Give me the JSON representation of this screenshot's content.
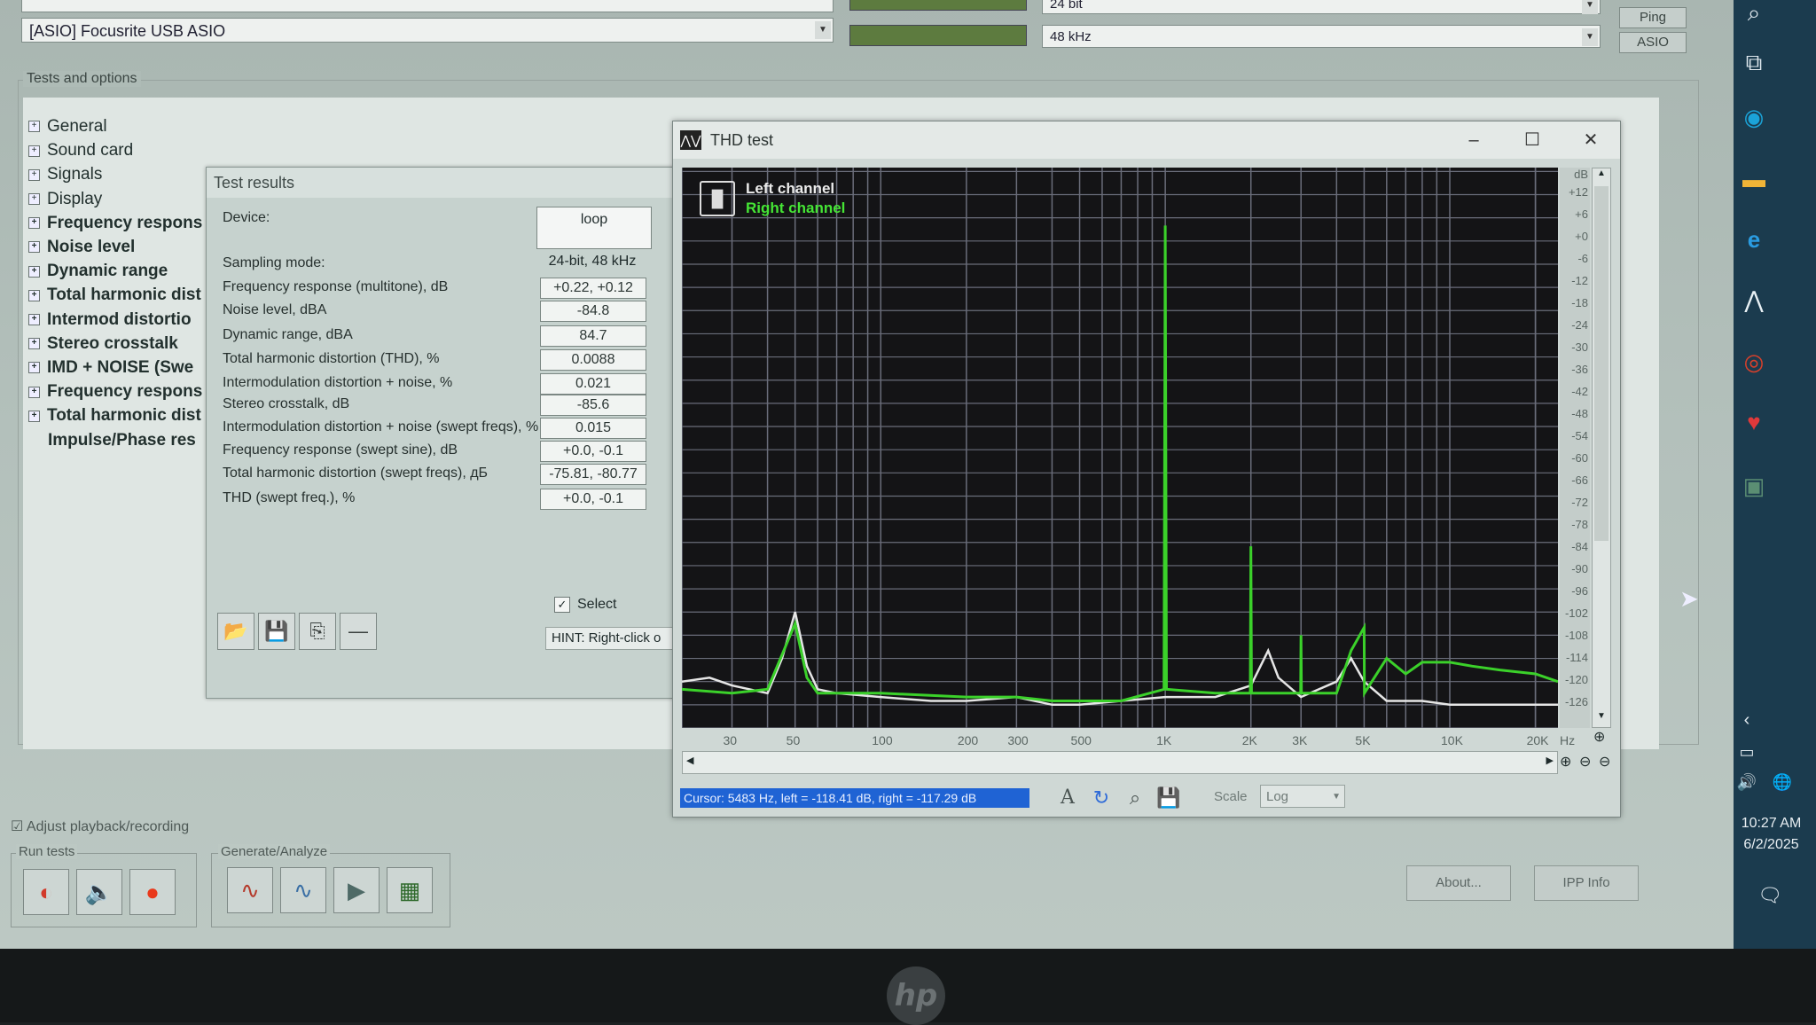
{
  "top_devices": {
    "input_device": "[ASIO] Focusrite USB ASIO",
    "bitdepth": "24 bit",
    "samplerate": "48 kHz",
    "ping_label": "Ping",
    "asio_label": "ASIO"
  },
  "tests_group_title": "Tests and options",
  "tree_items": [
    {
      "label": "General",
      "bold": false
    },
    {
      "label": "Sound card",
      "bold": false
    },
    {
      "label": "Signals",
      "bold": false
    },
    {
      "label": "Display",
      "bold": false
    },
    {
      "label": "Frequency respons",
      "bold": true
    },
    {
      "label": "Noise level",
      "bold": true
    },
    {
      "label": "Dynamic range",
      "bold": true
    },
    {
      "label": "Total harmonic dist",
      "bold": true
    },
    {
      "label": "Intermod distortio",
      "bold": true
    },
    {
      "label": "Stereo crosstalk",
      "bold": true
    },
    {
      "label": "IMD + NOISE (Swe",
      "bold": true
    },
    {
      "label": "Frequency respons",
      "bold": true
    },
    {
      "label": "Total harmonic dist",
      "bold": true
    },
    {
      "label": "Impulse/Phase res",
      "bold": true
    }
  ],
  "results": {
    "title": "Test results",
    "device_label": "Device:",
    "device_value": "loop",
    "sampling_label": "Sampling mode:",
    "sampling_value": "24-bit, 48 kHz",
    "rows": [
      {
        "label": "Frequency response (multitone), dB",
        "value": "+0.22, +0.12"
      },
      {
        "label": "Noise level, dBA",
        "value": "-84.8"
      },
      {
        "label": "Dynamic range, dBA",
        "value": "84.7"
      },
      {
        "label": "Total harmonic distortion (THD), %",
        "value": "0.0088"
      },
      {
        "label": "Intermodulation distortion + noise, %",
        "value": "0.021"
      },
      {
        "label": "Stereo crosstalk, dB",
        "value": "-85.6"
      },
      {
        "label": "Intermodulation distortion + noise (swept freqs), %",
        "value": "0.015"
      },
      {
        "label": "Frequency response (swept sine), dB",
        "value": "+0.0, -0.1"
      },
      {
        "label": "Total harmonic distortion (swept freqs), дБ",
        "value": "-75.81, -80.77"
      },
      {
        "label": "THD (swept freq.), %",
        "value": "+0.0, -0.1"
      }
    ],
    "select_label": "Select",
    "hint": "HINT: Right-click o"
  },
  "thd": {
    "title": "THD test",
    "left_channel": "Left channel",
    "right_channel": "Right channel",
    "cursor_readout": "Cursor: 5483 Hz, left = -118.41 dB, right = -117.29 dB",
    "scale_label": "Scale",
    "scale_value": "Log",
    "db_unit": "dB",
    "hz_unit": "Hz",
    "colors": {
      "left": "#e6e6e6",
      "right": "#3bd12a",
      "grid": "#6a6d7a",
      "bg": "#141416"
    }
  },
  "chart_data": {
    "type": "line",
    "xscale": "log",
    "xlim": [
      20,
      24000
    ],
    "ylim": [
      -130,
      15
    ],
    "x_ticks": [
      "30",
      "50",
      "100",
      "200",
      "300",
      "500",
      "1K",
      "2K",
      "3K",
      "5K",
      "10K",
      "20K"
    ],
    "y_ticks": [
      "+12",
      "+6",
      "+0",
      "-6",
      "-12",
      "-18",
      "-24",
      "-30",
      "-36",
      "-42",
      "-48",
      "-54",
      "-60",
      "-66",
      "-72",
      "-78",
      "-84",
      "-90",
      "-96",
      "-102",
      "-108",
      "-114",
      "-120",
      "-126"
    ],
    "series": [
      {
        "name": "Left channel",
        "x": [
          20,
          25,
          30,
          40,
          45,
          50,
          55,
          60,
          70,
          100,
          150,
          200,
          300,
          400,
          500,
          700,
          1000,
          1500,
          2000,
          2300,
          2500,
          3000,
          4000,
          4500,
          5000,
          6000,
          8000,
          10000,
          15000,
          20000,
          24000
        ],
        "y": [
          -118,
          -117,
          -119,
          -121,
          -112,
          -100,
          -114,
          -120,
          -121,
          -122,
          -123,
          -123,
          -122,
          -124,
          -124,
          -123,
          -122,
          -122,
          -119,
          -110,
          -117,
          -122,
          -118,
          -112,
          -118,
          -123,
          -123,
          -124,
          -124,
          -124,
          -124
        ]
      },
      {
        "name": "Right channel",
        "x": [
          20,
          30,
          40,
          50,
          55,
          60,
          100,
          200,
          300,
          400,
          500,
          700,
          990,
          1000,
          1010,
          1500,
          1990,
          2000,
          2010,
          2500,
          2990,
          3000,
          3010,
          4000,
          4500,
          5000,
          5010,
          6000,
          7000,
          8000,
          10000,
          12000,
          15000,
          20000,
          24000
        ],
        "y": [
          -120,
          -121,
          -120,
          -103,
          -117,
          -121,
          -121,
          -122,
          -122,
          -123,
          -123,
          -123,
          -120,
          0,
          -120,
          -121,
          -121,
          -83,
          -121,
          -121,
          -121,
          -106,
          -121,
          -121,
          -110,
          -104,
          -121,
          -112,
          -116,
          -113,
          -113,
          -114,
          -115,
          -116,
          -118
        ]
      }
    ]
  },
  "bottom": {
    "adjust_label": "Adjust playback/recording",
    "run_tests_title": "Run tests",
    "generate_title": "Generate/Analyze",
    "about_label": "About...",
    "ipp_label": "IPP Info"
  },
  "taskbar": {
    "time": "10:27 AM",
    "date": "6/2/2025"
  }
}
